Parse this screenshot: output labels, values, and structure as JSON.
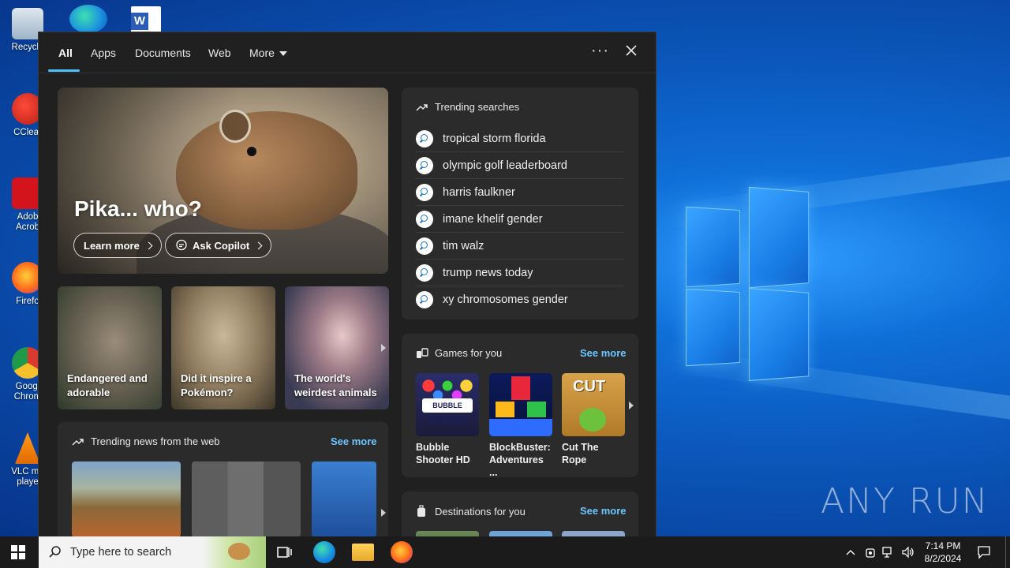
{
  "desktop": {
    "icons": [
      "Recycle",
      "CClear",
      "Adob Acrob",
      "Firefo",
      "Googl Chrom",
      "VLC me playe"
    ],
    "watermark": "ANY RUN"
  },
  "search_panel": {
    "tabs": [
      "All",
      "Apps",
      "Documents",
      "Web",
      "More"
    ],
    "active_tab": "All",
    "hero": {
      "title": "Pika... who?",
      "learn_more": "Learn more",
      "ask_copilot": "Ask Copilot"
    },
    "thumbnails": [
      "Endangered and adorable",
      "Did it inspire a Pokémon?",
      "The world's weirdest animals"
    ],
    "trending_news": {
      "title": "Trending news from the web",
      "see_more": "See more"
    },
    "trending_searches": {
      "title": "Trending searches",
      "items": [
        "tropical storm florida",
        "olympic golf leaderboard",
        "harris faulkner",
        "imane khelif gender",
        "tim walz",
        "trump news today",
        "xy chromosomes gender"
      ]
    },
    "games": {
      "title": "Games for you",
      "see_more": "See more",
      "items": [
        "Bubble Shooter HD",
        "BlockBuster: Adventures ...",
        "Cut The Rope"
      ]
    },
    "destinations": {
      "title": "Destinations for you",
      "see_more": "See more"
    }
  },
  "taskbar": {
    "search_placeholder": "Type here to search",
    "time": "7:14 PM",
    "date": "8/2/2024"
  }
}
